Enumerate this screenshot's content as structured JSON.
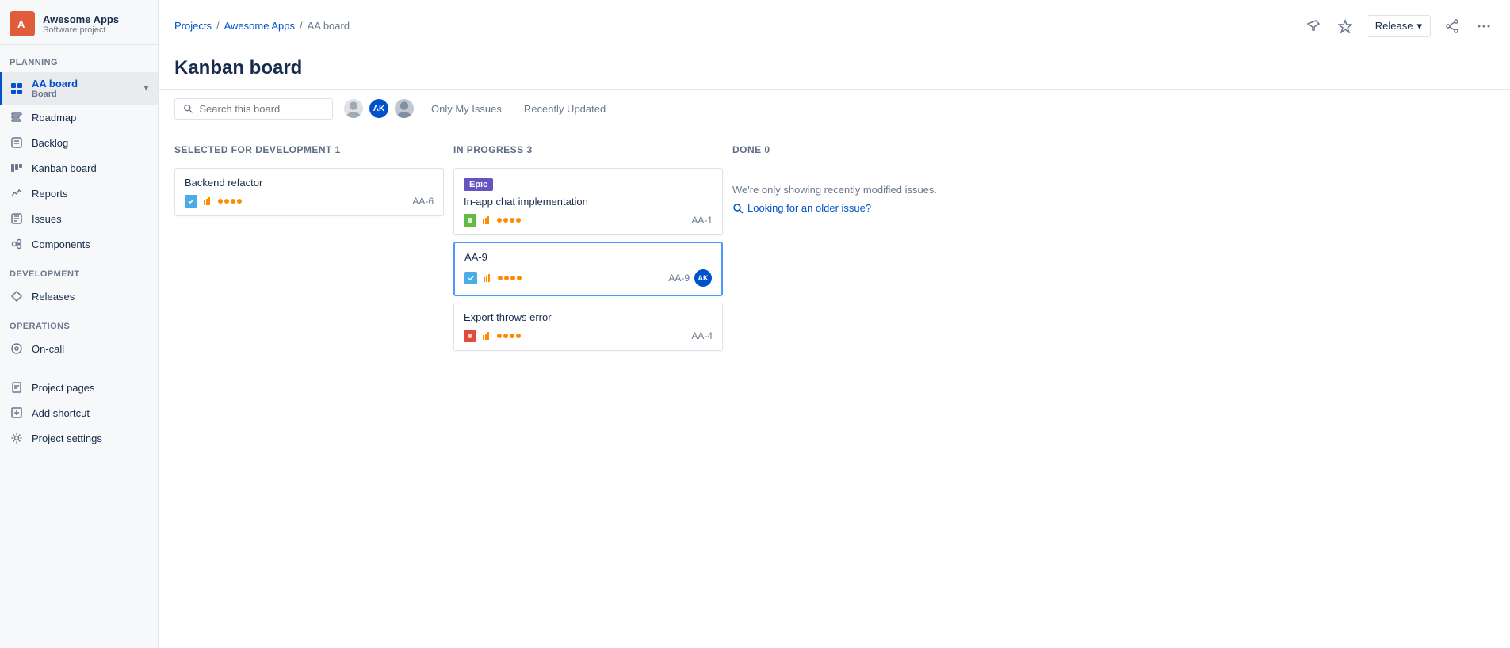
{
  "app": {
    "project_logo": "A",
    "project_name": "Awesome Apps",
    "project_sub": "Software project"
  },
  "sidebar": {
    "planning_label": "PLANNING",
    "development_label": "DEVELOPMENT",
    "operations_label": "OPERATIONS",
    "items": {
      "aa_board": "AA board",
      "aa_board_sub": "Board",
      "roadmap": "Roadmap",
      "backlog": "Backlog",
      "kanban_board": "Kanban board",
      "reports": "Reports",
      "issues": "Issues",
      "components": "Components",
      "releases": "Releases",
      "on_call": "On-call",
      "project_pages": "Project pages",
      "add_shortcut": "Add shortcut",
      "project_settings": "Project settings"
    }
  },
  "breadcrumb": {
    "projects": "Projects",
    "awesome_apps": "Awesome Apps",
    "aa_board": "AA board"
  },
  "header": {
    "title": "Kanban board",
    "release_label": "Release"
  },
  "toolbar": {
    "search_placeholder": "Search this board",
    "only_my_issues": "Only My Issues",
    "recently_updated": "Recently Updated"
  },
  "board": {
    "columns": [
      {
        "id": "selected",
        "title": "SELECTED FOR DEVELOPMENT",
        "count": 1,
        "cards": [
          {
            "title": "Backend refactor",
            "type": "task",
            "priority": "medium",
            "id": "AA-6",
            "epic": null,
            "selected": false
          }
        ]
      },
      {
        "id": "in_progress",
        "title": "IN PROGRESS",
        "count": 3,
        "cards": [
          {
            "title": "In-app chat implementation",
            "type": "story",
            "priority": "medium",
            "id": "AA-1",
            "epic": "Epic",
            "selected": false
          },
          {
            "title": "AA-9",
            "type": "task",
            "priority": "medium",
            "id": "AA-9",
            "epic": null,
            "selected": true,
            "assignee": "AK"
          },
          {
            "title": "Export throws error",
            "type": "bug",
            "priority": "medium",
            "id": "AA-4",
            "epic": null,
            "selected": false
          }
        ]
      },
      {
        "id": "done",
        "title": "DONE",
        "count": 0,
        "empty_message": "We're only showing recently modified issues.",
        "looking_link": "Looking for an older issue?"
      }
    ]
  },
  "icons": {
    "pin": "📌",
    "star": "☆",
    "share": "⬆",
    "more": "•••",
    "search": "🔍",
    "chevron_down": "▾",
    "aa9_title": "AA-9"
  }
}
